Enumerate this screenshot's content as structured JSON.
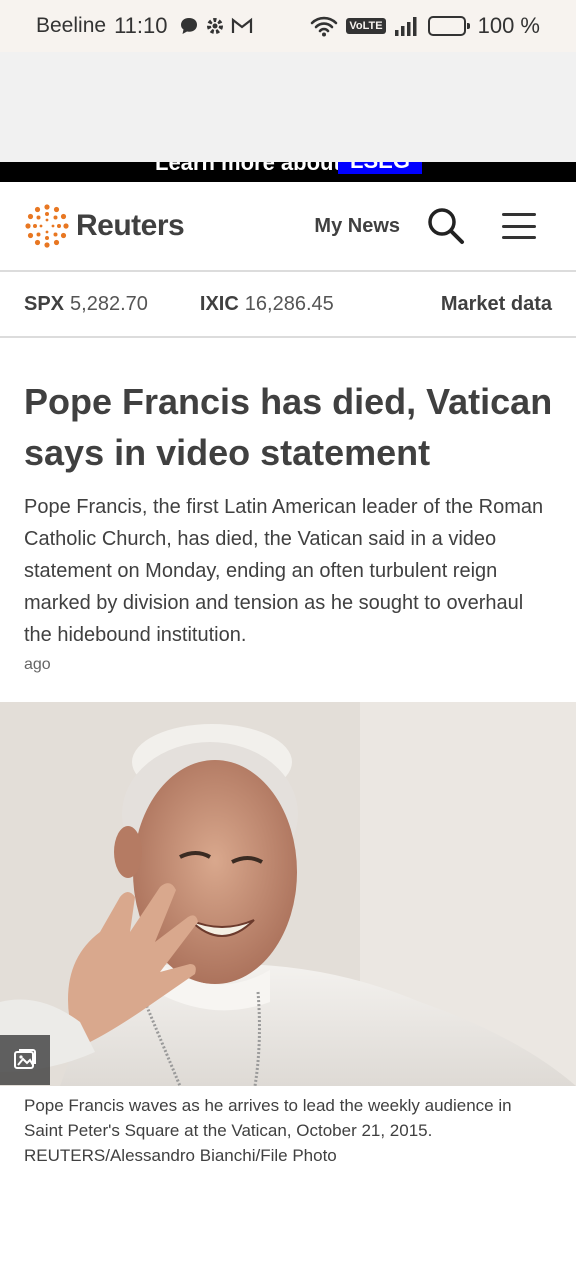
{
  "status_bar": {
    "carrier": "Beeline",
    "time": "11:10",
    "volte": "VoLTE",
    "battery": "100 %",
    "icons_left": [
      "chat-bubble-icon",
      "settings-gear-icon",
      "gmail-icon"
    ],
    "icons_right": [
      "wifi-icon",
      "volte-icon",
      "signal-icon",
      "battery-icon"
    ]
  },
  "ad": {
    "text": "Learn more about",
    "brand": "LSEG"
  },
  "header": {
    "logo": "Reuters",
    "my_news": "My News",
    "icons": [
      "search-icon",
      "hamburger-menu-icon"
    ]
  },
  "market": {
    "tickers": [
      {
        "symbol": "SPX",
        "value": "5,282.70"
      },
      {
        "symbol": "IXIC",
        "value": "16,286.45"
      }
    ],
    "link": "Market data"
  },
  "article": {
    "headline": "Pope Francis has died, Vatican says in video statement",
    "summary": "Pope Francis, the first Latin American leader of the Roman Catholic Church, has died, the Vatican said in a video statement on Monday, ending an often turbulent reign marked by division and tension as he sought to overhaul the hidebound institution.",
    "time_ago": "ago",
    "caption": "Pope Francis waves as he arrives to lead the weekly audience in Saint Peter's Square at the Vatican, October 21, 2015. REUTERS/Alessandro Bianchi/File Photo"
  },
  "colors": {
    "text": "#404040",
    "ad_brand": "#0000ff",
    "status_bg": "#f7f3ef",
    "logo_accent": "#e87722"
  }
}
